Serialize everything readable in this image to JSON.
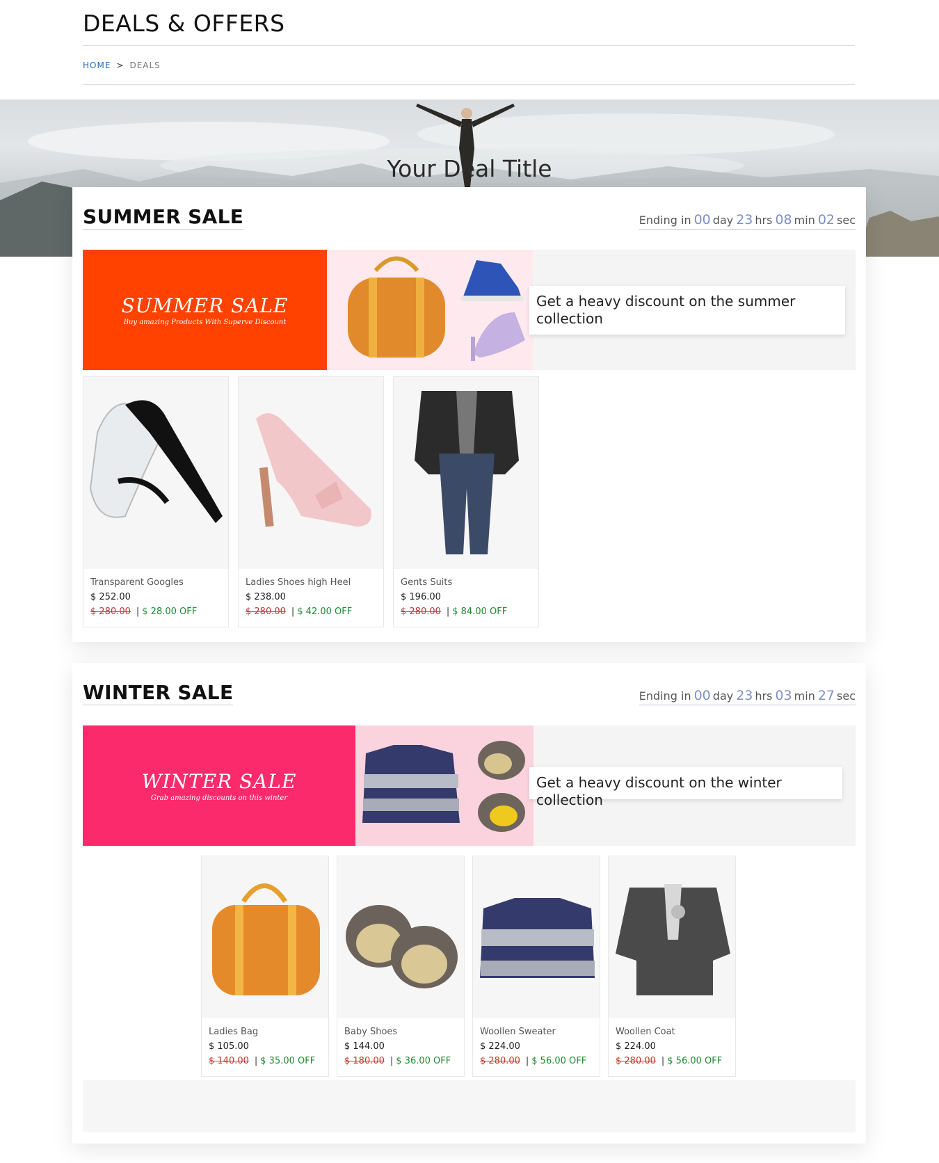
{
  "page": {
    "title": "DEALS & OFFERS",
    "breadcrumb": {
      "home": "HOME",
      "separator": ">",
      "current": "DEALS"
    }
  },
  "hero": {
    "title": "Your Deal Title"
  },
  "summer": {
    "title": "SUMMER SALE",
    "countdown": {
      "prefix": "Ending in",
      "day": "00",
      "day_label": "day",
      "hrs": "23",
      "hrs_label": "hrs",
      "min": "08",
      "min_label": "min",
      "sec": "02",
      "sec_label": "sec"
    },
    "promo": {
      "title": "SUMMER SALE",
      "subtitle": "Buy amazing Products With Superve Discount",
      "color": "#ff4200"
    },
    "callout": "Get a heavy discount on the summer collection",
    "products": [
      {
        "name": "Transparent Googles",
        "price": "$ 252.00",
        "old_price": "$ 280.00",
        "off": "$ 28.00 OFF",
        "icon": "goggles-image"
      },
      {
        "name": "Ladies Shoes high Heel",
        "price": "$ 238.00",
        "old_price": "$ 280.00",
        "off": "$ 42.00 OFF",
        "icon": "heel-shoe-image"
      },
      {
        "name": "Gents Suits",
        "price": "$ 196.00",
        "old_price": "$ 280.00",
        "off": "$ 84.00 OFF",
        "icon": "suit-image"
      }
    ]
  },
  "winter": {
    "title": "WINTER SALE",
    "countdown": {
      "prefix": "Ending in",
      "day": "00",
      "day_label": "day",
      "hrs": "23",
      "hrs_label": "hrs",
      "min": "03",
      "min_label": "min",
      "sec": "27",
      "sec_label": "sec"
    },
    "promo": {
      "title": "WINTER SALE",
      "subtitle": "Grab amazing discounts on this winter",
      "color": "#fb2a6c"
    },
    "callout": "Get a heavy discount on the winter collection",
    "products": [
      {
        "name": "Ladies Bag",
        "price": "$ 105.00",
        "old_price": "$ 140.00",
        "off": "$ 35.00 OFF",
        "icon": "handbag-image"
      },
      {
        "name": "Baby Shoes",
        "price": "$ 144.00",
        "old_price": "$ 180.00",
        "off": "$ 36.00 OFF",
        "icon": "baby-shoes-image"
      },
      {
        "name": "Woollen Sweater",
        "price": "$ 224.00",
        "old_price": "$ 280.00",
        "off": "$ 56.00 OFF",
        "icon": "sweater-image"
      },
      {
        "name": "Woollen Coat",
        "price": "$ 224.00",
        "old_price": "$ 280.00",
        "off": "$ 56.00 OFF",
        "icon": "coat-image"
      }
    ]
  },
  "colors": {
    "accent_link": "#1a6fc4",
    "countdown_number": "#7f8fc9",
    "old_price": "#c0392b",
    "discount": "#1e8a2e"
  }
}
